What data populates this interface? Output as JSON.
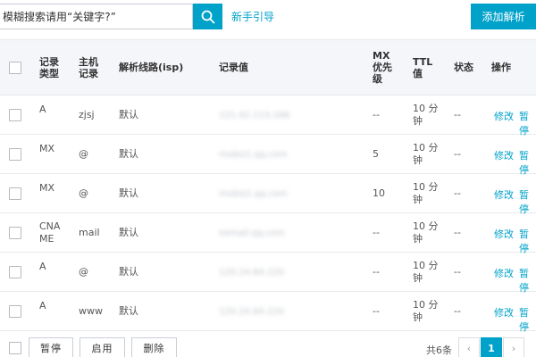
{
  "search": {
    "placeholder": "模糊搜索请用“关键字?”"
  },
  "guide_link": "新手引导",
  "add_button": "添加解析",
  "columns": {
    "type": [
      "记录",
      "类型"
    ],
    "host": [
      "主机",
      "记录"
    ],
    "line": "解析线路(isp)",
    "value": "记录值",
    "mx": [
      "MX",
      "优先",
      "级"
    ],
    "ttl": [
      "TTL",
      "值"
    ],
    "status": "状态",
    "ops": "操作"
  },
  "rows": [
    {
      "type": [
        "A"
      ],
      "host": "zjsj",
      "line": "默认",
      "value": "121.42.113.166",
      "mx": "--",
      "ttl": [
        "10 分",
        "钟"
      ],
      "status": "--",
      "edit": "修改",
      "pause": "暂停"
    },
    {
      "type": [
        "MX"
      ],
      "host": "@",
      "line": "默认",
      "value": "mxbiz1.qq.com",
      "mx": "5",
      "ttl": [
        "10 分",
        "钟"
      ],
      "status": "--",
      "edit": "修改",
      "pause": "暂停"
    },
    {
      "type": [
        "MX"
      ],
      "host": "@",
      "line": "默认",
      "value": "mxbiz2.qq.com",
      "mx": "10",
      "ttl": [
        "10 分",
        "钟"
      ],
      "status": "--",
      "edit": "修改",
      "pause": "暂停"
    },
    {
      "type": [
        "CNA",
        "ME"
      ],
      "host": "mail",
      "line": "默认",
      "value": "exmail.qq.com",
      "mx": "--",
      "ttl": [
        "10 分",
        "钟"
      ],
      "status": "--",
      "edit": "修改",
      "pause": "暂停"
    },
    {
      "type": [
        "A"
      ],
      "host": "@",
      "line": "默认",
      "value": "120.24.84.220",
      "mx": "--",
      "ttl": [
        "10 分",
        "钟"
      ],
      "status": "--",
      "edit": "修改",
      "pause": "暂停"
    },
    {
      "type": [
        "A"
      ],
      "host": "www",
      "line": "默认",
      "value": "120.24.84.220",
      "mx": "--",
      "ttl": [
        "10 分",
        "钟"
      ],
      "status": "--",
      "edit": "修改",
      "pause": "暂停"
    }
  ],
  "footer": {
    "pause": "暂停",
    "enable": "启用",
    "delete": "删除",
    "total": "共6条",
    "prev": "‹",
    "page": "1",
    "next": "›"
  },
  "colors": {
    "accent": "#00a2ca",
    "header_bg": "#f5f6fa"
  }
}
